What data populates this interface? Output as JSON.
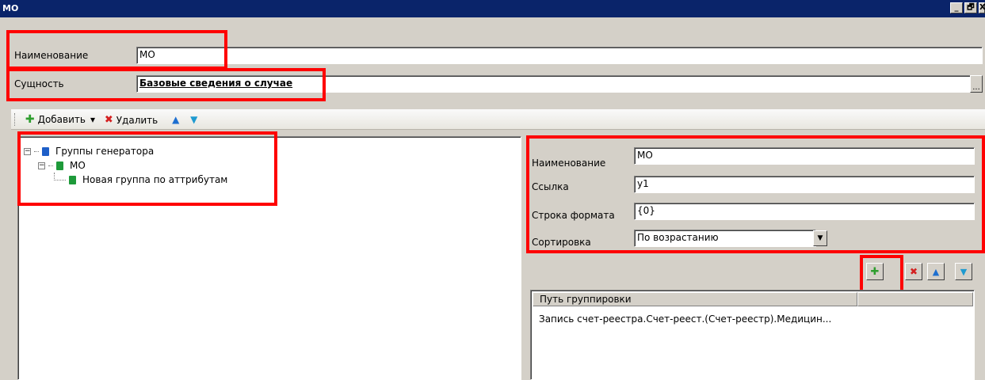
{
  "window": {
    "title": "МО",
    "minimize": "_",
    "restore": "🗗",
    "close": "X"
  },
  "form": {
    "name_label": "Наименование",
    "name_value": "МО",
    "entity_label": "Сущность",
    "entity_value": "Базовые сведения о случае",
    "entity_browse": "..."
  },
  "toolbar": {
    "add_label": "Добавить",
    "add_dropdown": "▾",
    "delete_label": "Удалить"
  },
  "tree": {
    "root": "Группы генератора",
    "child": "МО",
    "grandchild": "Новая группа по аттрибутам"
  },
  "details": {
    "name_label": "Наименование",
    "name_value": "МО",
    "link_label": "Ссылка",
    "link_value": "у1",
    "format_label": "Строка формата",
    "format_value": "{0}",
    "sort_label": "Сортировка",
    "sort_value": "По возрастанию"
  },
  "path_table": {
    "header": "Путь группировки",
    "rows": [
      "Запись счет-реестра.Счет-реест.(Счет-реестр).Медицин..."
    ]
  },
  "colors": {
    "title_bar": "#0a246a",
    "highlight": "#ff0000",
    "add_icon": "#2e9e2e",
    "delete_icon": "#d42020",
    "move_up_icon": "#1e6fd0",
    "move_down_icon": "#1e9ad0",
    "book_blue": "#1e5fc8",
    "book_green": "#1e9a3a"
  }
}
